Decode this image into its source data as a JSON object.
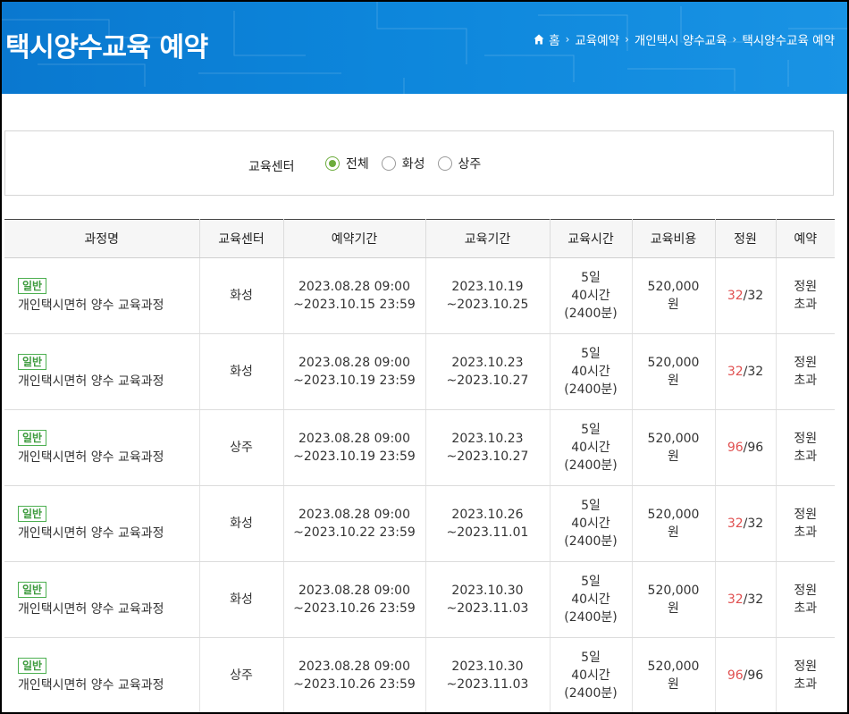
{
  "page": {
    "title": "택시양수교육 예약",
    "breadcrumb": [
      "홈",
      "교육예약",
      "개인택시 양수교육",
      "택시양수교육 예약"
    ]
  },
  "filter": {
    "label": "교육센터",
    "options": [
      "전체",
      "화성",
      "상주"
    ],
    "selected": "전체"
  },
  "table": {
    "headers": [
      "과정명",
      "교육센터",
      "예약기간",
      "교육기간",
      "교육시간",
      "교육비용",
      "정원",
      "예약"
    ],
    "rows": [
      {
        "badge": "일반",
        "course": "개인택시면허 양수 교육과정",
        "center": "화성",
        "res_start": "2023.08.28 09:00",
        "res_end": "~2023.10.15 23:59",
        "edu_start": "2023.10.19",
        "edu_end": "~2023.10.25",
        "days": "5일",
        "hours": "40시간",
        "minutes": "(2400분)",
        "cost": "520,000",
        "unit": "원",
        "cap_current": "32",
        "cap_total": "/32",
        "status1": "정원",
        "status2": "초과"
      },
      {
        "badge": "일반",
        "course": "개인택시면허 양수 교육과정",
        "center": "화성",
        "res_start": "2023.08.28 09:00",
        "res_end": "~2023.10.19 23:59",
        "edu_start": "2023.10.23",
        "edu_end": "~2023.10.27",
        "days": "5일",
        "hours": "40시간",
        "minutes": "(2400분)",
        "cost": "520,000",
        "unit": "원",
        "cap_current": "32",
        "cap_total": "/32",
        "status1": "정원",
        "status2": "초과"
      },
      {
        "badge": "일반",
        "course": "개인택시면허 양수 교육과정",
        "center": "상주",
        "res_start": "2023.08.28 09:00",
        "res_end": "~2023.10.19 23:59",
        "edu_start": "2023.10.23",
        "edu_end": "~2023.10.27",
        "days": "5일",
        "hours": "40시간",
        "minutes": "(2400분)",
        "cost": "520,000",
        "unit": "원",
        "cap_current": "96",
        "cap_total": "/96",
        "status1": "정원",
        "status2": "초과"
      },
      {
        "badge": "일반",
        "course": "개인택시면허 양수 교육과정",
        "center": "화성",
        "res_start": "2023.08.28 09:00",
        "res_end": "~2023.10.22 23:59",
        "edu_start": "2023.10.26",
        "edu_end": "~2023.11.01",
        "days": "5일",
        "hours": "40시간",
        "minutes": "(2400분)",
        "cost": "520,000",
        "unit": "원",
        "cap_current": "32",
        "cap_total": "/32",
        "status1": "정원",
        "status2": "초과"
      },
      {
        "badge": "일반",
        "course": "개인택시면허 양수 교육과정",
        "center": "화성",
        "res_start": "2023.08.28 09:00",
        "res_end": "~2023.10.26 23:59",
        "edu_start": "2023.10.30",
        "edu_end": "~2023.11.03",
        "days": "5일",
        "hours": "40시간",
        "minutes": "(2400분)",
        "cost": "520,000",
        "unit": "원",
        "cap_current": "32",
        "cap_total": "/32",
        "status1": "정원",
        "status2": "초과"
      },
      {
        "badge": "일반",
        "course": "개인택시면허 양수 교육과정",
        "center": "상주",
        "res_start": "2023.08.28 09:00",
        "res_end": "~2023.10.26 23:59",
        "edu_start": "2023.10.30",
        "edu_end": "~2023.11.03",
        "days": "5일",
        "hours": "40시간",
        "minutes": "(2400분)",
        "cost": "520,000",
        "unit": "원",
        "cap_current": "96",
        "cap_total": "/96",
        "status1": "정원",
        "status2": "초과"
      }
    ]
  },
  "colors": {
    "banner": "#0d86db",
    "accent_green": "#6cac3c",
    "capacity_red": "#e05050"
  }
}
